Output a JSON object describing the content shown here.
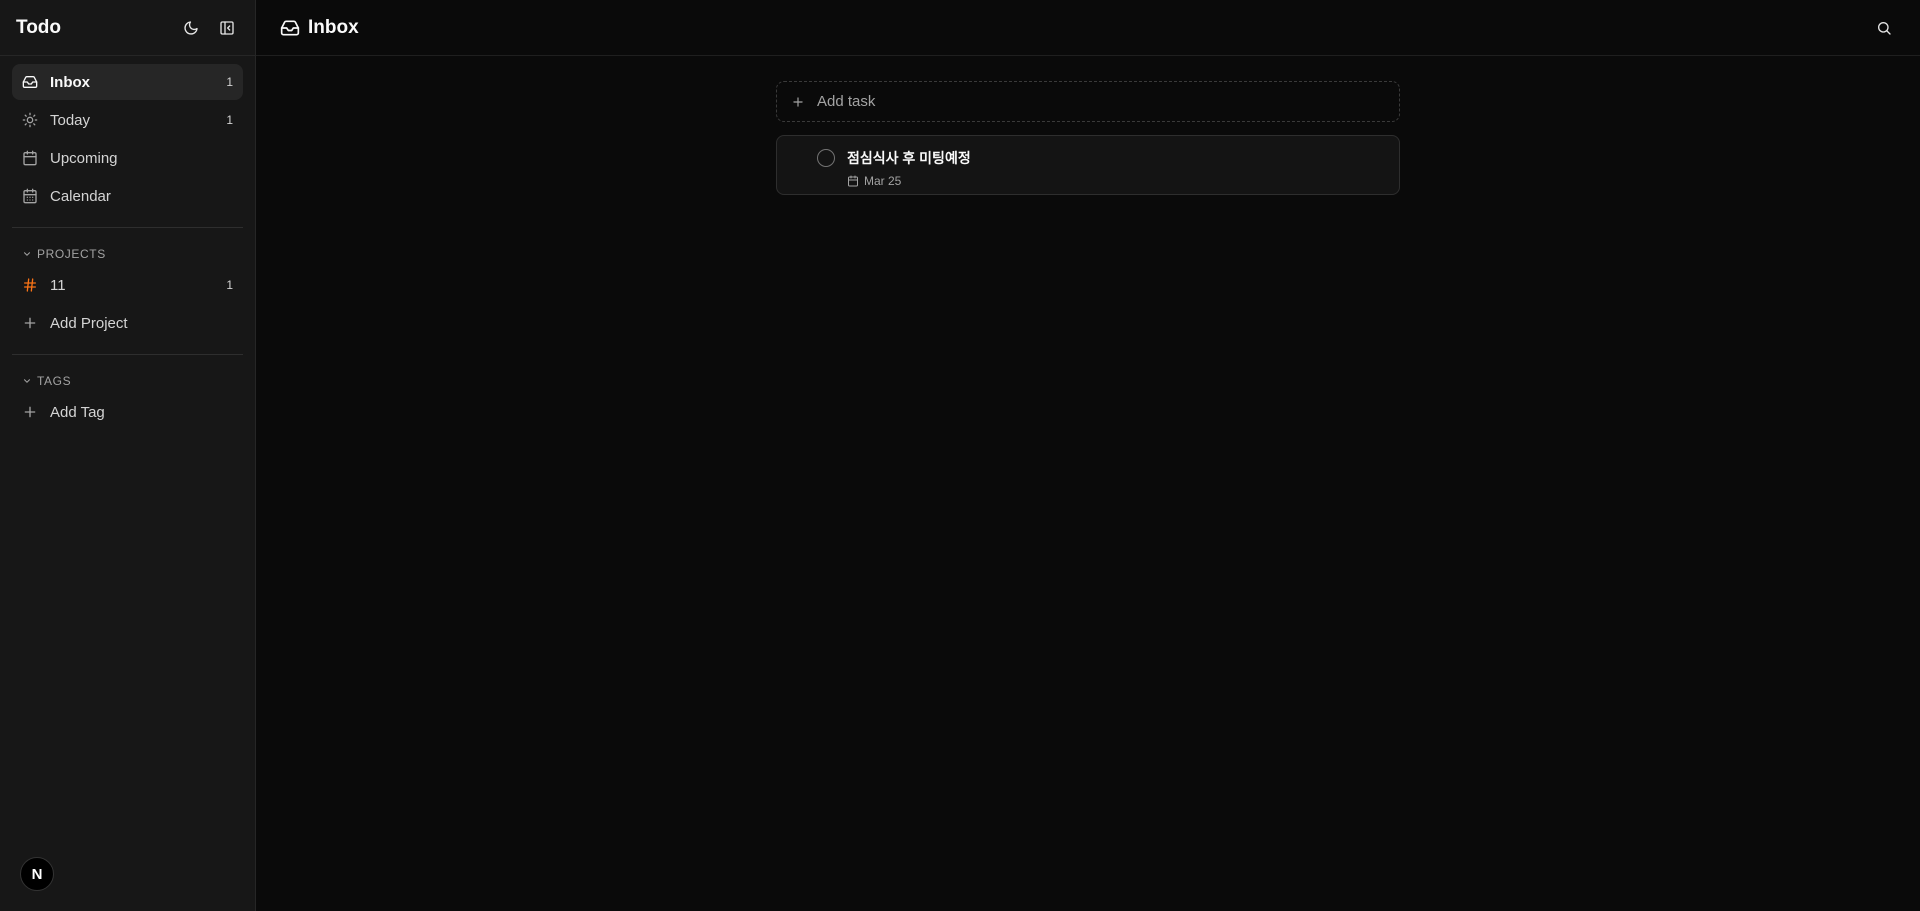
{
  "app": {
    "title": "Todo"
  },
  "sidebar": {
    "nav": [
      {
        "label": "Inbox",
        "count": "1",
        "icon": "inbox-icon",
        "active": true
      },
      {
        "label": "Today",
        "count": "1",
        "icon": "sun-icon"
      },
      {
        "label": "Upcoming",
        "count": "",
        "icon": "calendar-icon"
      },
      {
        "label": "Calendar",
        "count": "",
        "icon": "calendar-grid-icon"
      }
    ],
    "projects": {
      "header": "PROJECTS",
      "items": [
        {
          "label": "11",
          "count": "1",
          "icon": "hash-icon",
          "color": "#f97316"
        }
      ],
      "add_label": "Add Project"
    },
    "tags": {
      "header": "TAGS",
      "add_label": "Add Tag"
    },
    "avatar_letter": "N"
  },
  "main": {
    "title": "Inbox",
    "add_task_label": "Add task",
    "tasks": [
      {
        "title": "점심식사 후 미팅예정",
        "date": "Mar 25"
      }
    ]
  },
  "colors": {
    "accent": "#f97316",
    "background": "#0a0a0a",
    "sidebar": "#171717"
  }
}
